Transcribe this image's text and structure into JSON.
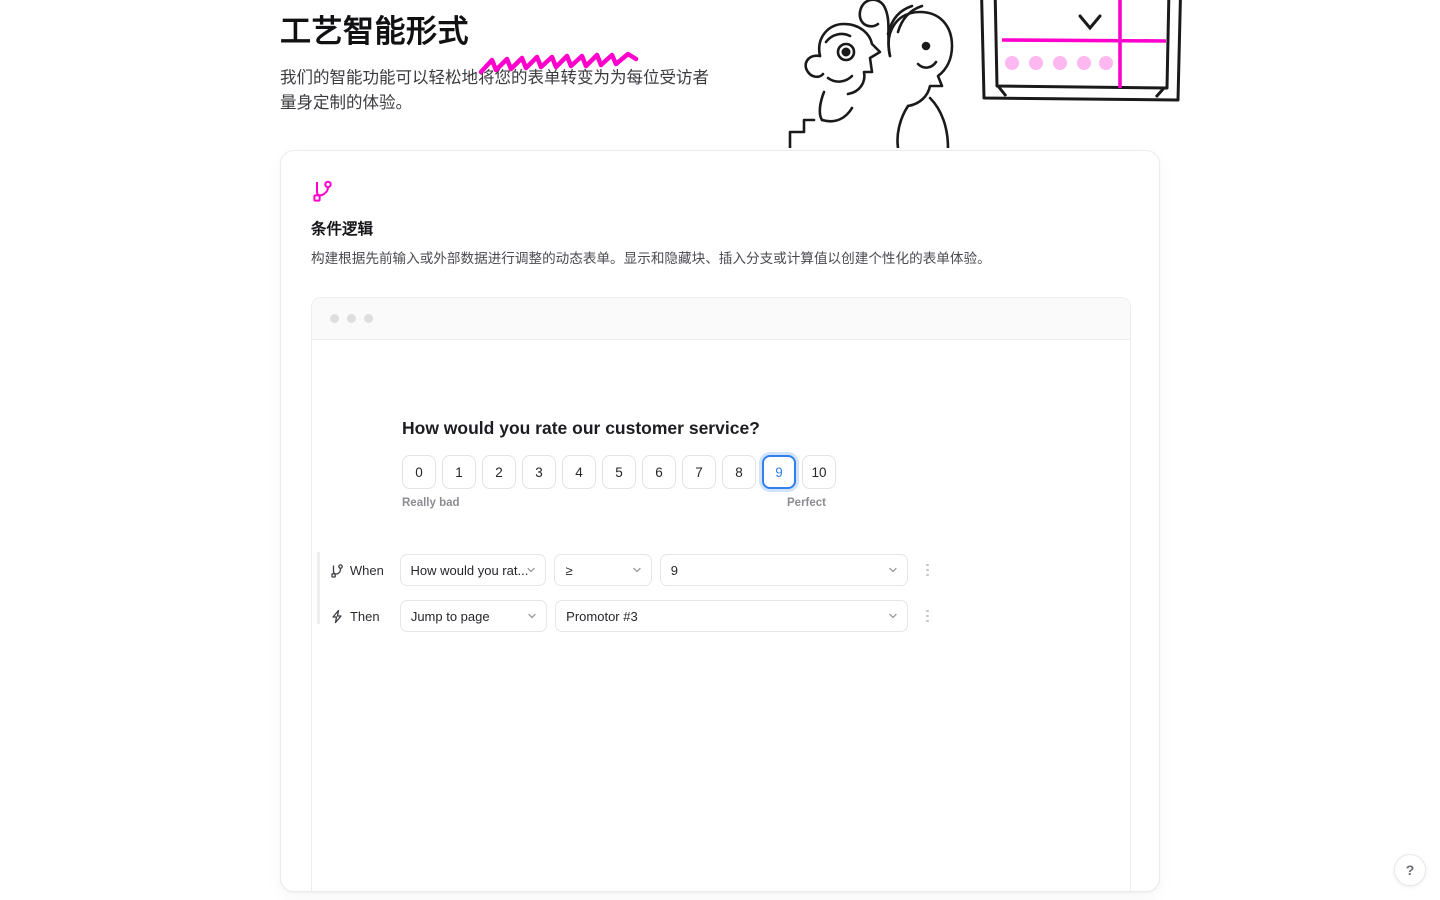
{
  "hero": {
    "title": "工艺智能形式",
    "subtitle": "我们的智能功能可以轻松地将您的表单转变为为每位受访者量身定制的体验。"
  },
  "feature_card": {
    "icon": "branch-icon",
    "title": "条件逻辑",
    "description": "构建根据先前输入或外部数据进行调整的动态表单。显示和隐藏块、插入分支或计算值以创建个性化的表单体验。"
  },
  "browser_mock": {
    "window_dots": 3
  },
  "form_preview": {
    "question": "How would you rate our customer service?",
    "scale_options": [
      "0",
      "1",
      "2",
      "3",
      "4",
      "5",
      "6",
      "7",
      "8",
      "9",
      "10"
    ],
    "selected_value": "9",
    "low_label": "Really bad",
    "high_label": "Perfect",
    "selected_color": "#2f80ed"
  },
  "logic_rules": [
    {
      "icon": "branch-icon",
      "label": "When",
      "fields": [
        {
          "name": "field-select",
          "value": "How would you rat..."
        },
        {
          "name": "operator-select",
          "value": "≥"
        },
        {
          "name": "value-select",
          "value": "9"
        }
      ]
    },
    {
      "icon": "lightning-icon",
      "label": "Then",
      "fields": [
        {
          "name": "action-select",
          "value": "Jump to page"
        },
        {
          "name": "target-select",
          "value": "Promotor #3"
        }
      ]
    }
  ],
  "help_button": {
    "label": "?"
  },
  "colors": {
    "accent_pink": "#ff00cc",
    "accent_blue": "#2f80ed",
    "border": "#e6e6e9",
    "text": "#26262c"
  }
}
